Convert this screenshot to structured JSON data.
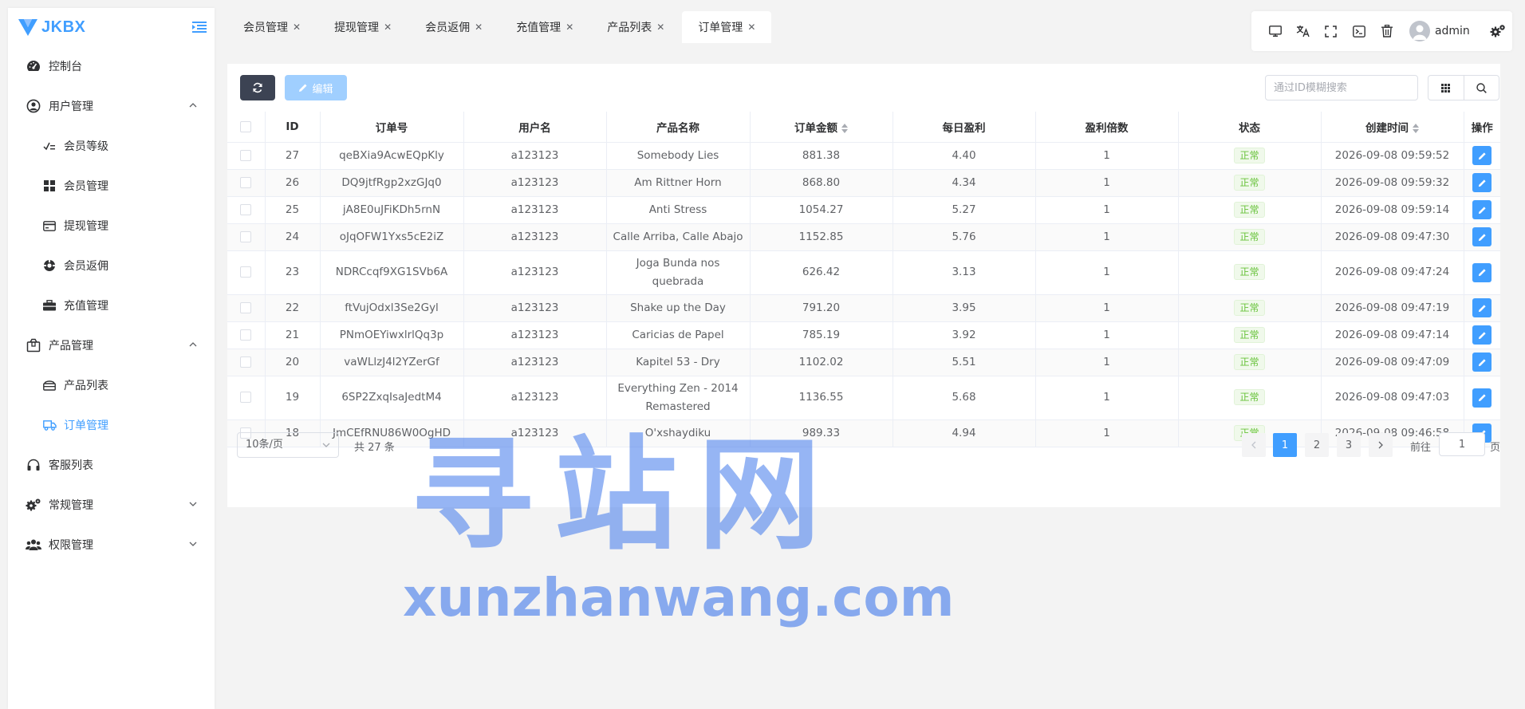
{
  "app": {
    "brand": "JKBX"
  },
  "sidebar": {
    "items": [
      {
        "label": "控制台",
        "icon": "dashboard-icon"
      },
      {
        "label": "用户管理",
        "icon": "user-circle-icon",
        "expanded": true,
        "children": [
          {
            "label": "会员等级",
            "icon": "ranking-icon"
          },
          {
            "label": "会员管理",
            "icon": "grid-icon"
          },
          {
            "label": "提现管理",
            "icon": "card-icon"
          },
          {
            "label": "会员返佣",
            "icon": "commission-icon"
          },
          {
            "label": "充值管理",
            "icon": "briefcase-icon"
          }
        ]
      },
      {
        "label": "产品管理",
        "icon": "product-box-icon",
        "expanded": true,
        "children": [
          {
            "label": "产品列表",
            "icon": "product-list-icon"
          },
          {
            "label": "订单管理",
            "icon": "truck-icon",
            "active": true
          }
        ]
      },
      {
        "label": "客服列表",
        "icon": "headset-icon"
      },
      {
        "label": "常规管理",
        "icon": "gears-icon",
        "expanded": false
      },
      {
        "label": "权限管理",
        "icon": "users-icon",
        "expanded": false
      }
    ]
  },
  "tabs": [
    {
      "label": "会员管理"
    },
    {
      "label": "提现管理"
    },
    {
      "label": "会员返佣"
    },
    {
      "label": "充值管理"
    },
    {
      "label": "产品列表"
    },
    {
      "label": "订单管理",
      "active": true
    }
  ],
  "header": {
    "username": "admin"
  },
  "toolbar": {
    "edit_label": "编辑",
    "search_placeholder": "通过ID模糊搜索"
  },
  "table": {
    "columns": [
      "ID",
      "订单号",
      "用户名",
      "产品名称",
      "订单金额",
      "每日盈利",
      "盈利倍数",
      "状态",
      "创建时间",
      "操作"
    ],
    "rows": [
      {
        "id": "27",
        "order_no": "qeBXia9AcwEQpKly",
        "user": "a123123",
        "product": "Somebody Lies",
        "amount": "881.38",
        "daily": "4.40",
        "multiple": "1",
        "status": "正常",
        "created": "2026-09-08 09:59:52"
      },
      {
        "id": "26",
        "order_no": "DQ9jtfRgp2xzGJq0",
        "user": "a123123",
        "product": "Am Rittner Horn",
        "amount": "868.80",
        "daily": "4.34",
        "multiple": "1",
        "status": "正常",
        "created": "2026-09-08 09:59:32"
      },
      {
        "id": "25",
        "order_no": "jA8E0uJFiKDh5rnN",
        "user": "a123123",
        "product": "Anti Stress",
        "amount": "1054.27",
        "daily": "5.27",
        "multiple": "1",
        "status": "正常",
        "created": "2026-09-08 09:59:14"
      },
      {
        "id": "24",
        "order_no": "oJqOFW1Yxs5cE2iZ",
        "user": "a123123",
        "product": "Calle Arriba, Calle Abajo",
        "amount": "1152.85",
        "daily": "5.76",
        "multiple": "1",
        "status": "正常",
        "created": "2026-09-08 09:47:30"
      },
      {
        "id": "23",
        "order_no": "NDRCcqf9XG1SVb6A",
        "user": "a123123",
        "product": "Joga Bunda nos quebrada",
        "amount": "626.42",
        "daily": "3.13",
        "multiple": "1",
        "status": "正常",
        "created": "2026-09-08 09:47:24",
        "tall": true
      },
      {
        "id": "22",
        "order_no": "ftVujOdxl3Se2Gyl",
        "user": "a123123",
        "product": "Shake up the Day",
        "amount": "791.20",
        "daily": "3.95",
        "multiple": "1",
        "status": "正常",
        "created": "2026-09-08 09:47:19"
      },
      {
        "id": "21",
        "order_no": "PNmOEYiwxlrlQq3p",
        "user": "a123123",
        "product": "Caricias de Papel",
        "amount": "785.19",
        "daily": "3.92",
        "multiple": "1",
        "status": "正常",
        "created": "2026-09-08 09:47:14"
      },
      {
        "id": "20",
        "order_no": "vaWLlzJ4l2YZerGf",
        "user": "a123123",
        "product": "Kapitel 53 - Dry",
        "amount": "1102.02",
        "daily": "5.51",
        "multiple": "1",
        "status": "正常",
        "created": "2026-09-08 09:47:09"
      },
      {
        "id": "19",
        "order_no": "6SP2ZxqIsaJedtM4",
        "user": "a123123",
        "product": "Everything Zen - 2014 Remastered",
        "amount": "1136.55",
        "daily": "5.68",
        "multiple": "1",
        "status": "正常",
        "created": "2026-09-08 09:47:03",
        "tall": true
      },
      {
        "id": "18",
        "order_no": "JmCEfRNU86W0OgHD",
        "user": "a123123",
        "product": "O'xshaydiku",
        "amount": "989.33",
        "daily": "4.94",
        "multiple": "1",
        "status": "正常",
        "created": "2026-09-08 09:46:58"
      }
    ]
  },
  "pagination": {
    "page_size": "10条/页",
    "total": "共 27 条",
    "pages": [
      "1",
      "2",
      "3"
    ],
    "current": "1",
    "goto_prefix": "前往",
    "goto_value": "1",
    "goto_suffix": "页"
  },
  "watermark": {
    "cn": "寻站网",
    "en": "xunzhanwang.com"
  },
  "colors": {
    "accent": "#409eff",
    "dark_button": "#3c4353",
    "status_ok": "#67c23a"
  }
}
